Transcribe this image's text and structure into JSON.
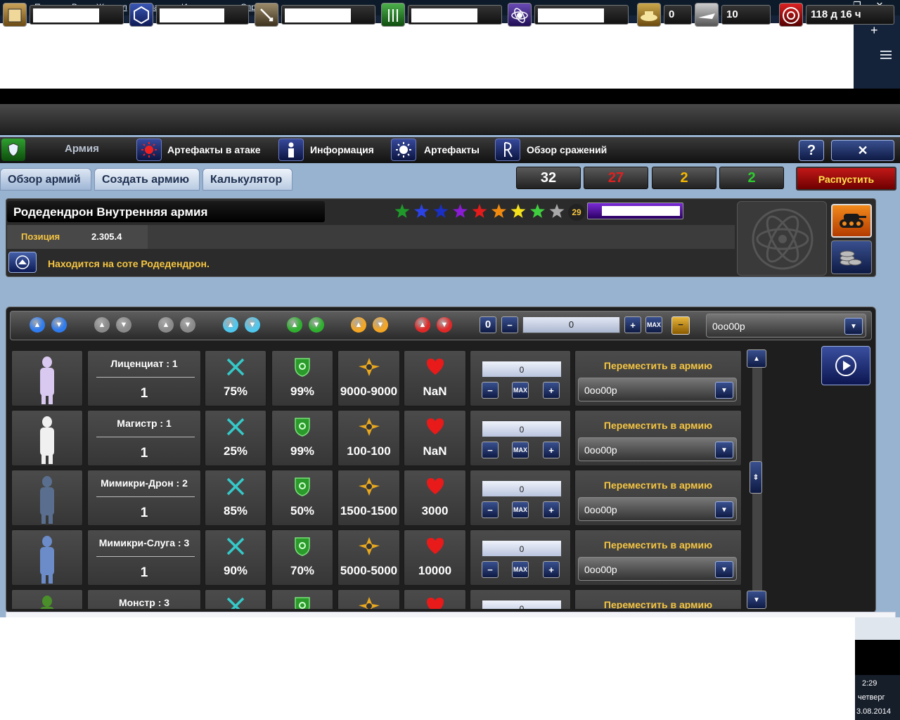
{
  "menu": [
    "Файл",
    "Правка",
    "Вид",
    "Журнал",
    "Закладки",
    "Инструменты",
    "Справка"
  ],
  "resources": [
    {
      "icon": "metal-icon",
      "value": ""
    },
    {
      "icon": "crystal-icon",
      "value": ""
    },
    {
      "icon": "deuterium-icon",
      "value": ""
    },
    {
      "icon": "food-icon",
      "value": ""
    },
    {
      "icon": "energy-icon",
      "value": ""
    },
    {
      "icon": "transport-ship-icon",
      "value": "0"
    },
    {
      "icon": "war-ship-icon",
      "value": "10"
    },
    {
      "icon": "timer-icon",
      "value": "118 д 16 ч"
    }
  ],
  "nav": {
    "army": "Армия",
    "attack_artifacts": "Артефакты в атаке",
    "info": "Информация",
    "artifacts": "Артефакты",
    "battles": "Обзор сражений"
  },
  "tabs": [
    "Обзор армий",
    "Создать армию",
    "Калькулятор"
  ],
  "counters": [
    {
      "value": "32",
      "color": "#ffffff"
    },
    {
      "value": "27",
      "color": "#e02020"
    },
    {
      "value": "2",
      "color": "#f5b800"
    },
    {
      "value": "2",
      "color": "#2ecc2e"
    }
  ],
  "disband": "Распустить",
  "army": {
    "name": "Родедендрон Внутренняя армия",
    "position_label": "Позиция",
    "position_value": "2.305.4",
    "location": "Находится на соте Родедендрон.",
    "stars": [
      "#1f9a2a",
      "#2b42e6",
      "#1a2fc4",
      "#8a1cd6",
      "#e31b1b",
      "#f28a10",
      "#f5e11c",
      "#3fcf3f",
      "#a9a9a9"
    ],
    "star_count": "29"
  },
  "filter": {
    "count": "0",
    "amount": "0",
    "max": "MAX",
    "dropdown": "0oo00p"
  },
  "units": [
    {
      "name": "Лиценциат : 1",
      "count": "1",
      "attack": "75%",
      "defense": "99%",
      "damage": "9000-9000",
      "hp": "NaN",
      "qty": "0"
    },
    {
      "name": "Магистр : 1",
      "count": "1",
      "attack": "25%",
      "defense": "99%",
      "damage": "100-100",
      "hp": "NaN",
      "qty": "0"
    },
    {
      "name": "Мимикри-Дрон : 2",
      "count": "1",
      "attack": "85%",
      "defense": "50%",
      "damage": "1500-1500",
      "hp": "3000",
      "qty": "0"
    },
    {
      "name": "Мимикри-Слуга : 3",
      "count": "1",
      "attack": "90%",
      "defense": "70%",
      "damage": "5000-5000",
      "hp": "10000",
      "qty": "0"
    },
    {
      "name": "Монстр : 3",
      "count": "",
      "attack": "",
      "defense": "",
      "damage": "",
      "hp": "",
      "qty": "0"
    }
  ],
  "move_label": "Переместить в армию",
  "move_dropdown": "0oo00p",
  "max_label": "MAX",
  "clock": {
    "time": "2:29",
    "day": "четверг",
    "date": "3.08.2014"
  }
}
